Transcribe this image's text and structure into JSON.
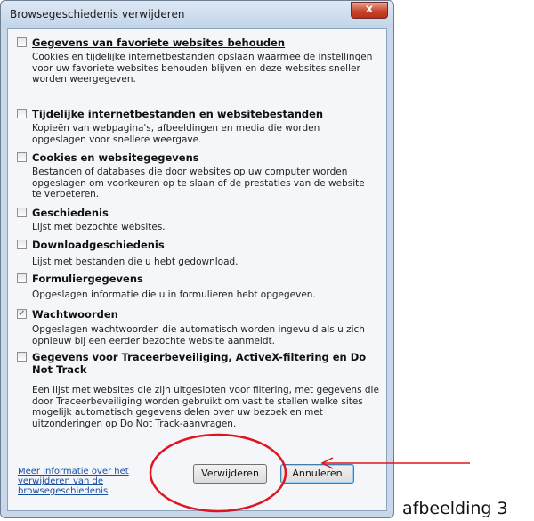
{
  "dialog": {
    "title": "Browsegeschiedenis verwijderen",
    "close_label": "x",
    "options": [
      {
        "label": "Gegevens van favoriete websites behouden",
        "checked": false,
        "description": [
          "Cookies en tijdelijke internetbestanden opslaan waarmee de instellingen",
          "voor uw favoriete websites behouden blijven en deze websites sneller",
          "worden weergegeven."
        ]
      },
      {
        "label": "Tijdelijke internetbestanden en websitebestanden",
        "checked": false,
        "description": [
          "Kopieën van webpagina's, afbeeldingen en media die worden",
          "opgeslagen voor snellere weergave."
        ]
      },
      {
        "label": "Cookies en websitegegevens",
        "checked": false,
        "description": [
          "Bestanden of databases die door websites op uw computer worden",
          "opgeslagen om voorkeuren op te slaan of de prestaties van de website",
          "te verbeteren."
        ]
      },
      {
        "label": "Geschiedenis",
        "checked": false,
        "description": [
          "Lijst met bezochte websites."
        ]
      },
      {
        "label": "Downloadgeschiedenis",
        "checked": false,
        "description": [
          "Lijst met bestanden die u hebt gedownload."
        ]
      },
      {
        "label": "Formuliergegevens",
        "checked": false,
        "description": [
          "Opgeslagen informatie die u in formulieren hebt opgegeven."
        ]
      },
      {
        "label": "Wachtwoorden",
        "checked": true,
        "description": [
          "Opgeslagen wachtwoorden die automatisch worden ingevuld als u zich",
          "opnieuw bij een eerder bezochte website aanmeldt."
        ]
      },
      {
        "label": "Gegevens voor Traceerbeveiliging, ActiveX-filtering en Do Not Track",
        "checked": false,
        "description": [
          "Een lijst met websites die zijn uitgesloten voor filtering, met gegevens die",
          "door Traceerbeveiliging worden gebruikt om vast te stellen welke sites",
          "mogelijk automatisch gegevens delen over uw bezoek en met",
          "uitzonderingen op Do Not Track-aanvragen."
        ]
      }
    ],
    "more_info_link": "Meer informatie over het verwijderen van de browsegeschiedenis",
    "buttons": {
      "delete": "Verwijderen",
      "cancel": "Annuleren"
    }
  },
  "caption": "afbeelding 3",
  "colors": {
    "annotation": "#e0141e"
  }
}
